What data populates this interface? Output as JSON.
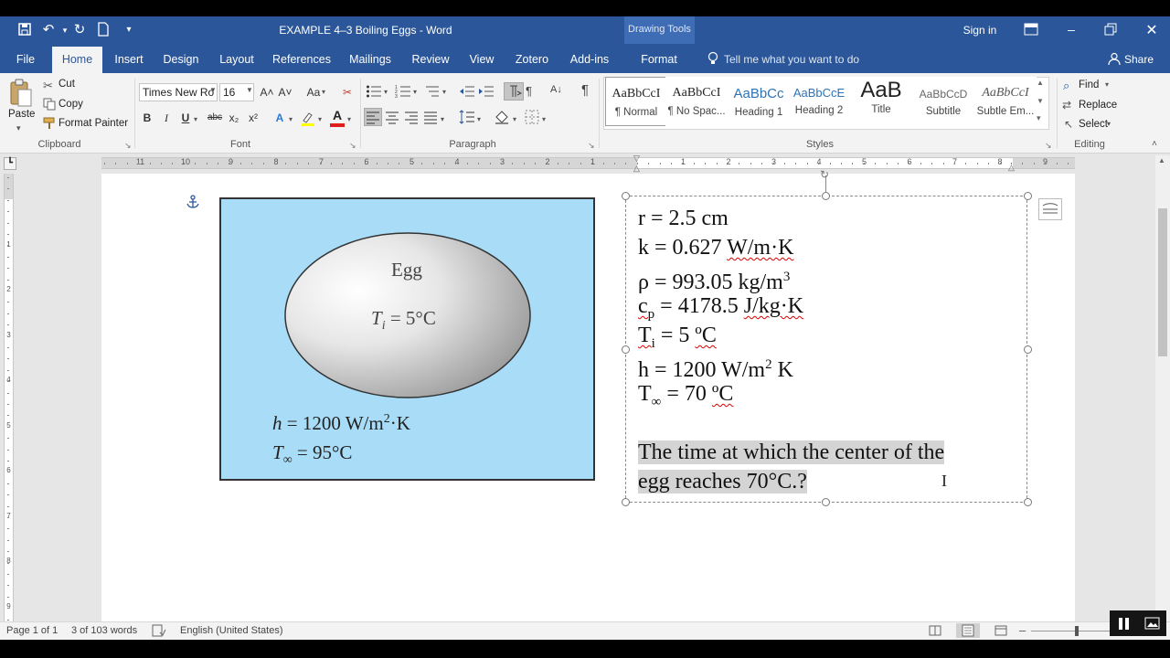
{
  "titlebar": {
    "doc_title": "EXAMPLE 4–3 Boiling Eggs - Word",
    "context_group": "Drawing Tools",
    "sign_in": "Sign in"
  },
  "tabs": {
    "file": "File",
    "home": "Home",
    "insert": "Insert",
    "design": "Design",
    "layout": "Layout",
    "references": "References",
    "mailings": "Mailings",
    "review": "Review",
    "view": "View",
    "zotero": "Zotero",
    "addins": "Add-ins",
    "format": "Format",
    "tell_me": "Tell me what you want to do",
    "share": "Share"
  },
  "clipboard": {
    "paste": "Paste",
    "cut": "Cut",
    "copy": "Copy",
    "format_painter": "Format Painter",
    "group": "Clipboard"
  },
  "font": {
    "name": "Times New Ro",
    "size": "16",
    "group": "Font",
    "bold": "B",
    "italic": "I",
    "underline": "U",
    "strike": "abc",
    "sub": "x₂",
    "sup": "x²",
    "grow": "A˄",
    "shrink": "A˅",
    "case": "Aa",
    "color_a": "A",
    "effects_a": "A"
  },
  "paragraph": {
    "group": "Paragraph",
    "pilcrow": "¶"
  },
  "styles": {
    "group": "Styles",
    "items": [
      {
        "preview": "AaBbCcI",
        "label": "¶ Normal"
      },
      {
        "preview": "AaBbCcI",
        "label": "¶ No Spac..."
      },
      {
        "preview": "AaBbCc",
        "label": "Heading 1"
      },
      {
        "preview": "AaBbCcE",
        "label": "Heading 2"
      },
      {
        "preview": "AaB",
        "label": "Title"
      },
      {
        "preview": "AaBbCcD",
        "label": "Subtitle"
      },
      {
        "preview": "AaBbCcI",
        "label": "Subtle Em..."
      }
    ]
  },
  "editing": {
    "group": "Editing",
    "find": "Find",
    "replace": "Replace",
    "select": "Select"
  },
  "ruler": {
    "left_ticks": [
      "11",
      "10",
      "9",
      "8",
      "7",
      "6",
      "5",
      "4",
      "3",
      "2",
      "1"
    ],
    "right_ticks": [
      "1",
      "2",
      "3",
      "4",
      "5",
      "6",
      "7",
      "8",
      "9"
    ],
    "v_ticks": [
      "1",
      "2",
      "3",
      "4",
      "5",
      "6",
      "7",
      "8",
      "9"
    ]
  },
  "figure": {
    "egg_label": "Egg",
    "ti_symbol": "T",
    "ti_sub": "i",
    "ti_value": " = 5°C",
    "h_symbol": "h",
    "h_value": " = 1200 W/m",
    "h_exp": "2",
    "h_unit": "·K",
    "tinf_symbol": "T",
    "tinf_sub": "∞",
    "tinf_value": " = 95°C",
    "fill_color": "#a8dcf7"
  },
  "textbox": {
    "r": "r = 2.5 cm",
    "k_a": "k = 0.627 ",
    "k_b": "W/m·K",
    "rho_a": "ρ = 993.05 kg/m",
    "rho_exp": "3",
    "cp_c": "c",
    "cp_p": "p",
    "cp_mid": " = 4178.5 ",
    "cp_unit": "J/kg·K",
    "ti_T": "T",
    "ti_i": "i",
    "ti_rest": " = 5 ",
    "ti_unit": "ºC",
    "h_a": "h = 1200 W/m",
    "h_exp": "2",
    "h_b": " K",
    "tinf_T": "T",
    "tinf_sub": "∞",
    "tinf_rest": " = 70 ",
    "tinf_unit": "ºC",
    "question_1": "The time at which the center of the ",
    "question_2": "egg reaches 70°C.? "
  },
  "status": {
    "page": "Page 1 of 1",
    "words": "3 of 103 words",
    "language": "English (United States)"
  }
}
